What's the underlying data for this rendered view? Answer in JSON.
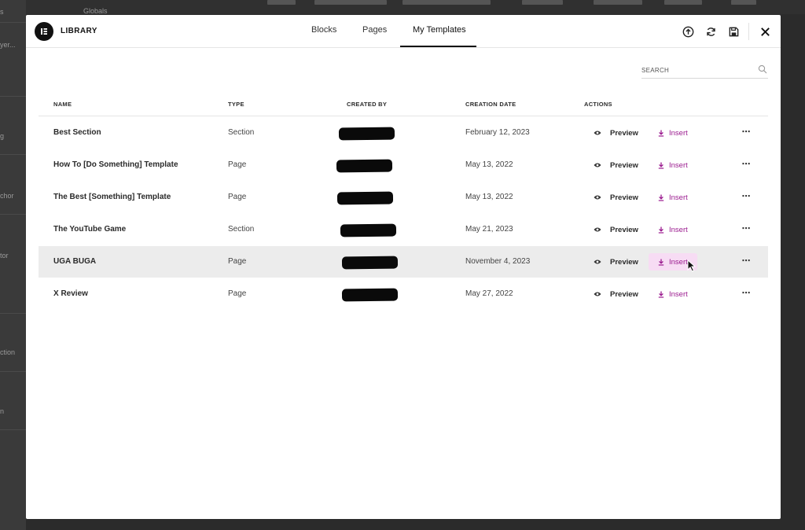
{
  "background": {
    "topbar_label": "Globals",
    "sidebar_fragments": [
      "s",
      "yer...",
      "g",
      "chor",
      "tor",
      "ction",
      "n"
    ]
  },
  "header": {
    "logo_letter": "E",
    "library_title": "LIBRARY",
    "tabs": [
      {
        "label": "Blocks",
        "active": false
      },
      {
        "label": "Pages",
        "active": false
      },
      {
        "label": "My Templates",
        "active": true
      }
    ],
    "buttons": {
      "import": "import-icon",
      "sync": "sync-icon",
      "save": "save-icon",
      "close": "close-icon"
    }
  },
  "search": {
    "placeholder": "SEARCH",
    "value": ""
  },
  "table": {
    "columns": [
      "NAME",
      "TYPE",
      "CREATED BY",
      "CREATION DATE",
      "ACTIONS"
    ],
    "rows": [
      {
        "name": "Best Section",
        "type": "Section",
        "created_by": "[redacted]",
        "date": "February 12, 2023",
        "preview": "Preview",
        "insert": "Insert",
        "more": "⋯"
      },
      {
        "name": "How To [Do Something] Template",
        "type": "Page",
        "created_by": "[redacted]",
        "date": "May 13, 2022",
        "preview": "Preview",
        "insert": "Insert",
        "more": "⋯"
      },
      {
        "name": "The Best [Something] Template",
        "type": "Page",
        "created_by": "[redacted]",
        "date": "May 13, 2022",
        "preview": "Preview",
        "insert": "Insert",
        "more": "⋯"
      },
      {
        "name": "The YouTube Game",
        "type": "Section",
        "created_by": "[redacted]",
        "date": "May 21, 2023",
        "preview": "Preview",
        "insert": "Insert",
        "more": "⋯"
      },
      {
        "name": "UGA BUGA",
        "type": "Page",
        "created_by": "[redacted]",
        "date": "November 4, 2023",
        "preview": "Preview",
        "insert": "Insert",
        "more": "⋯",
        "hovered": true
      },
      {
        "name": "X Review",
        "type": "Page",
        "created_by": "[redacted]",
        "date": "May 27, 2022",
        "preview": "Preview",
        "insert": "Insert",
        "more": "⋯"
      }
    ]
  },
  "colors": {
    "accent": "#9b1b8f",
    "hover_row": "#ececec",
    "insert_hover_bg": "#f7dcf4",
    "overlay": "#2b2b2b"
  }
}
